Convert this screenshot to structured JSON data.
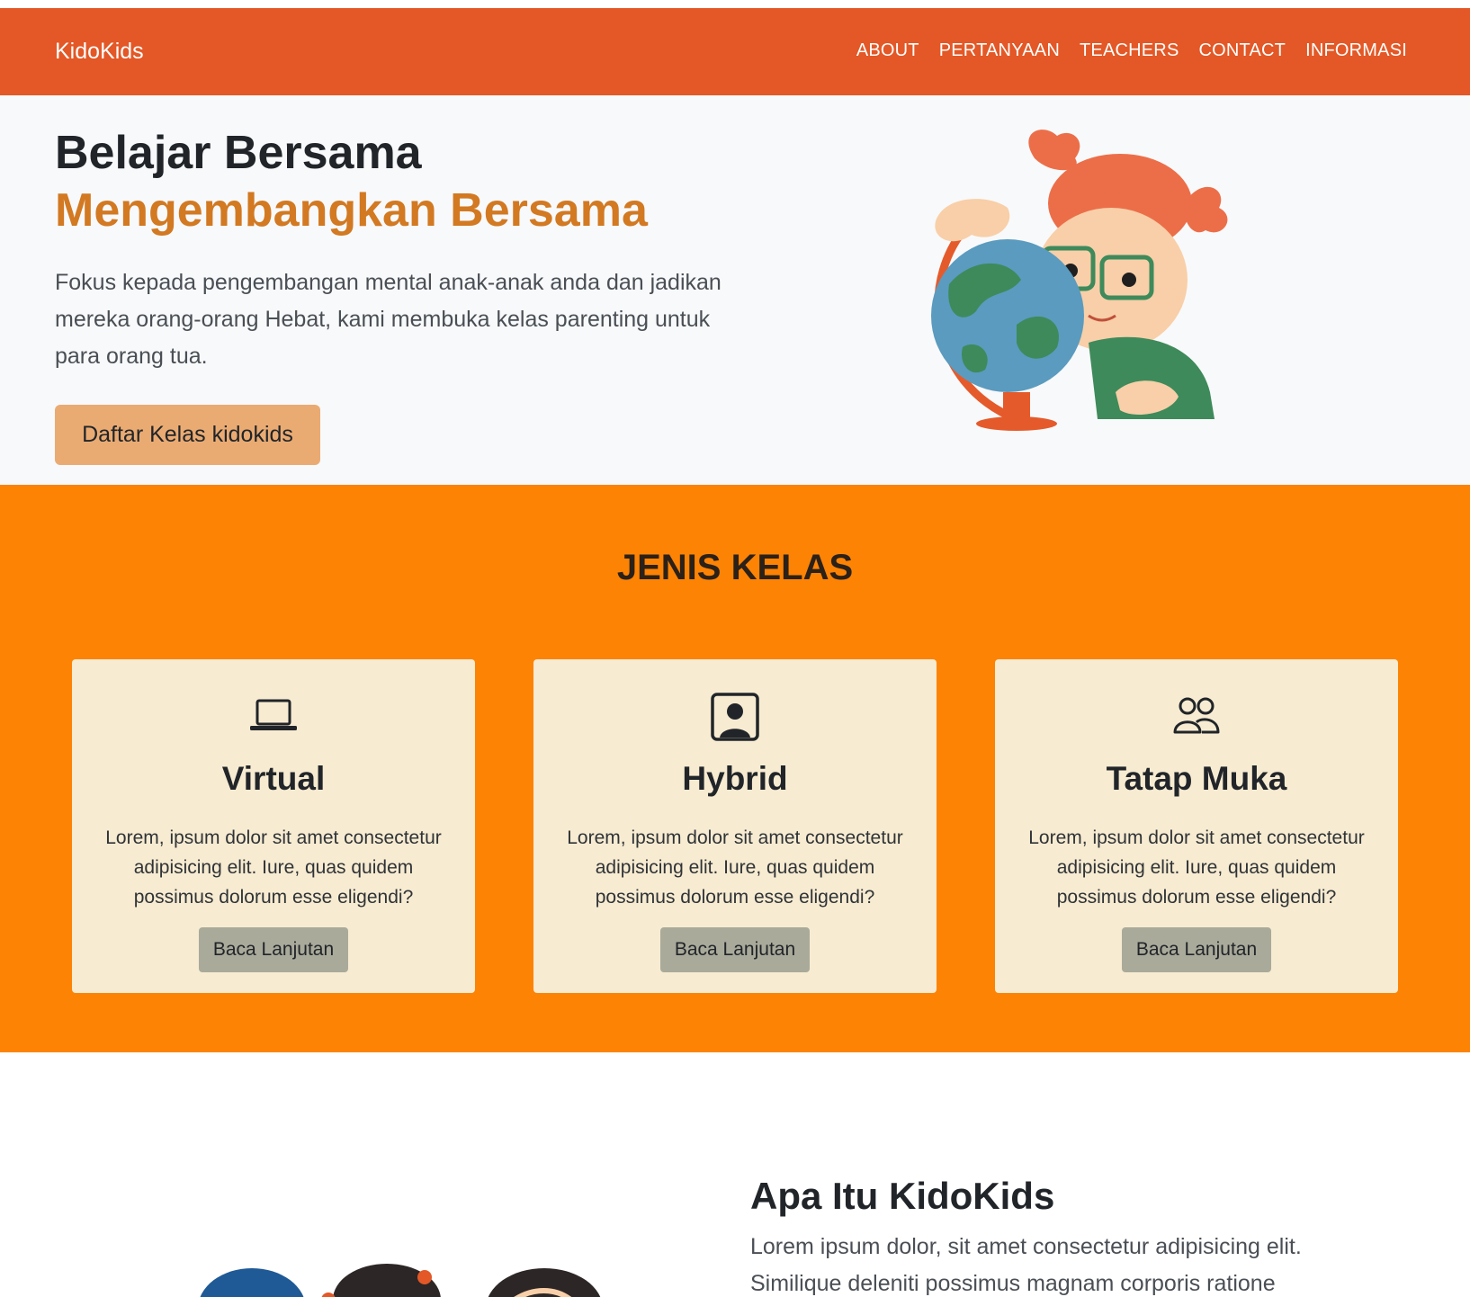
{
  "brand": "KidoKids",
  "nav": [
    "ABOUT",
    "PERTANYAAN",
    "TEACHERS",
    "CONTACT",
    "INFORMASI"
  ],
  "hero": {
    "title_line1": "Belajar Bersama",
    "title_line2": "Mengembangkan Bersama",
    "text": "Fokus kepada pengembangan mental anak-anak anda dan jadikan mereka orang-orang Hebat, kami membuka kelas parenting untuk para orang tua.",
    "cta": "Daftar Kelas kidokids"
  },
  "jenis": {
    "title": "JENIS KELAS",
    "cards": [
      {
        "icon": "laptop-icon",
        "title": "Virtual",
        "text": "Lorem, ipsum dolor sit amet consectetur adipisicing elit. Iure, quas quidem possimus dolorum esse eligendi?",
        "button": "Baca Lanjutan"
      },
      {
        "icon": "person-square-icon",
        "title": "Hybrid",
        "text": "Lorem, ipsum dolor sit amet consectetur adipisicing elit. Iure, quas quidem possimus dolorum esse eligendi?",
        "button": "Baca Lanjutan"
      },
      {
        "icon": "people-icon",
        "title": "Tatap Muka",
        "text": "Lorem, ipsum dolor sit amet consectetur adipisicing elit. Iure, quas quidem possimus dolorum esse eligendi?",
        "button": "Baca Lanjutan"
      }
    ]
  },
  "about": {
    "title": "Apa Itu KidoKids",
    "text": "Lorem ipsum dolor, sit amet consectetur adipisicing elit. Similique deleniti possimus magnam corporis ratione"
  },
  "colors": {
    "navbar": "#e35826",
    "accent_title": "#d27922",
    "hero_button": "#eaab73",
    "section_orange": "#fd8305",
    "card_bg": "#f7ebd1",
    "card_button": "#a9aa9a"
  }
}
